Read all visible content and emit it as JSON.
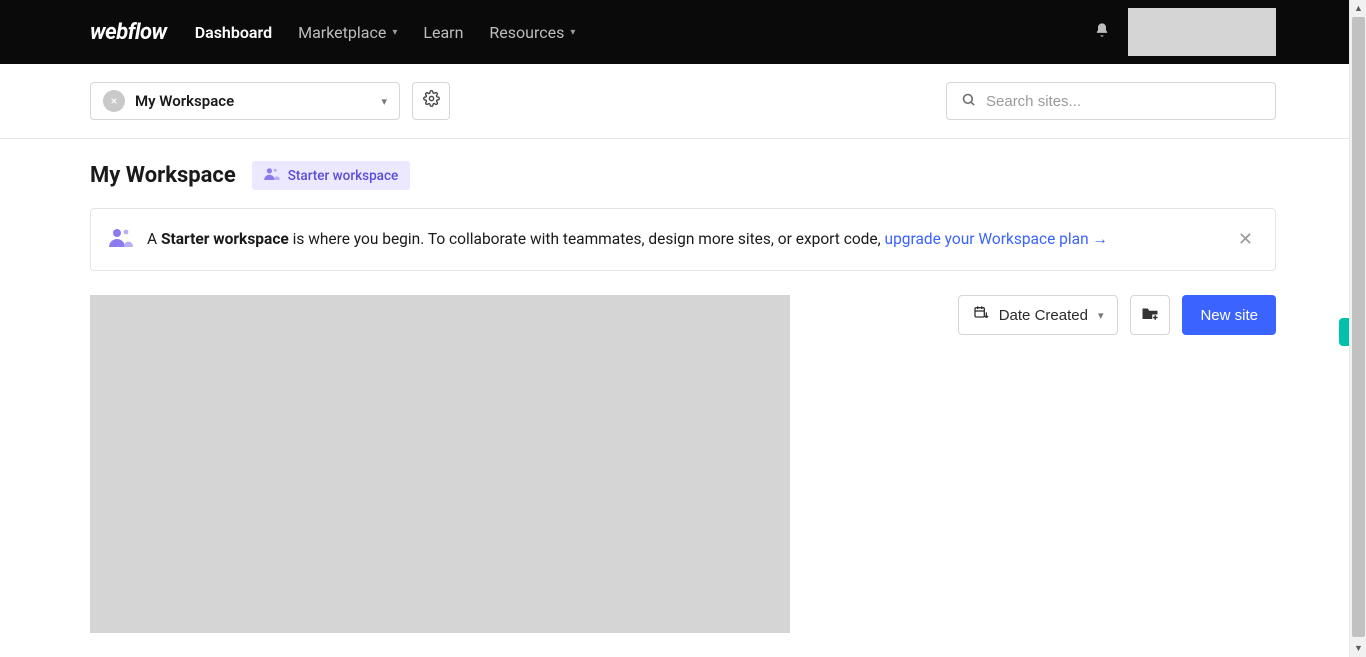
{
  "brand": "webflow",
  "nav": {
    "dashboard": "Dashboard",
    "marketplace": "Marketplace",
    "learn": "Learn",
    "resources": "Resources"
  },
  "workspace_selector": {
    "name": "My Workspace"
  },
  "search": {
    "placeholder": "Search sites..."
  },
  "page": {
    "title": "My Workspace",
    "plan_label": "Starter workspace"
  },
  "notice": {
    "prefix": "A ",
    "bold": "Starter workspace",
    "middle": " is where you begin. To collaborate with teammates, design more sites, or export code, ",
    "link": "upgrade your Workspace plan →"
  },
  "toolbar": {
    "sort_label": "Date Created",
    "new_site_label": "New site"
  }
}
